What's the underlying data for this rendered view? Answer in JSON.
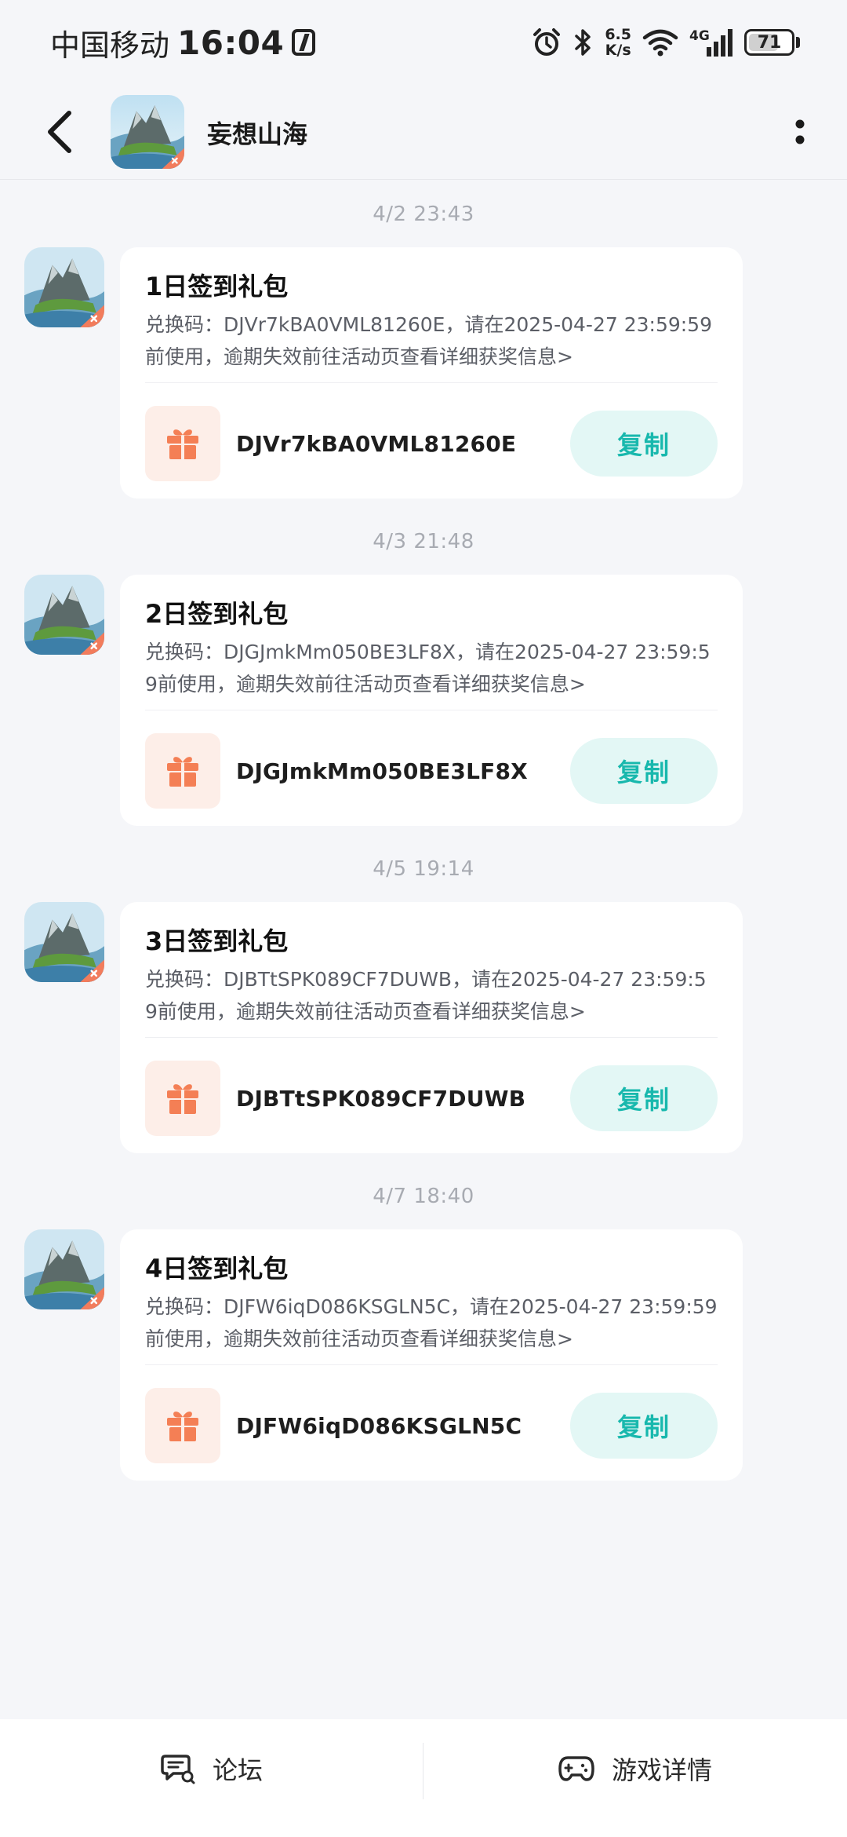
{
  "status_bar": {
    "carrier": "中国移动",
    "time": "16:04",
    "speed_value": "6.5",
    "speed_unit": "K/s",
    "network": "4G",
    "battery": "71",
    "battery_level": 0.71
  },
  "header": {
    "title": "妄想山海",
    "back_icon": "chevron-left-icon",
    "more_icon": "vertical-dots-icon"
  },
  "messages": [
    {
      "time": "4/2  23:43",
      "title": "1日签到礼包",
      "desc": "兑换码：DJVr7kBA0VML81260E，请在2025-04-27 23:59:59前使用，逾期失效前往活动页查看详细获奖信息>",
      "code": "DJVr7kBA0VML81260E",
      "copy_label": "复制"
    },
    {
      "time": "4/3  21:48",
      "title": "2日签到礼包",
      "desc": "兑换码：DJGJmkMm050BE3LF8X，请在2025-04-27 23:59:59前使用，逾期失效前往活动页查看详细获奖信息>",
      "code": "DJGJmkMm050BE3LF8X",
      "copy_label": "复制"
    },
    {
      "time": "4/5  19:14",
      "title": "3日签到礼包",
      "desc": "兑换码：DJBTtSPK089CF7DUWB，请在2025-04-27 23:59:59前使用，逾期失效前往活动页查看详细获奖信息>",
      "code": "DJBTtSPK089CF7DUWB",
      "copy_label": "复制"
    },
    {
      "time": "4/7  18:40",
      "title": "4日签到礼包",
      "desc": "兑换码：DJFW6iqD086KSGLN5C，请在2025-04-27 23:59:59前使用，逾期失效前往活动页查看详细获奖信息>",
      "code": "DJFW6iqD086KSGLN5C",
      "copy_label": "复制"
    }
  ],
  "bottom_bar": {
    "forum_label": "论坛",
    "forum_icon": "chat-bubble-icon",
    "details_label": "游戏详情",
    "details_icon": "gamepad-icon"
  },
  "colors": {
    "background": "#f5f6f9",
    "card": "#ffffff",
    "accent_teal": "#18b8ad",
    "copy_button_bg": "#e3f7f5",
    "gift_orange": "#f47f55",
    "gift_bg": "#fdeee8",
    "timestamp": "#a8abb2"
  }
}
